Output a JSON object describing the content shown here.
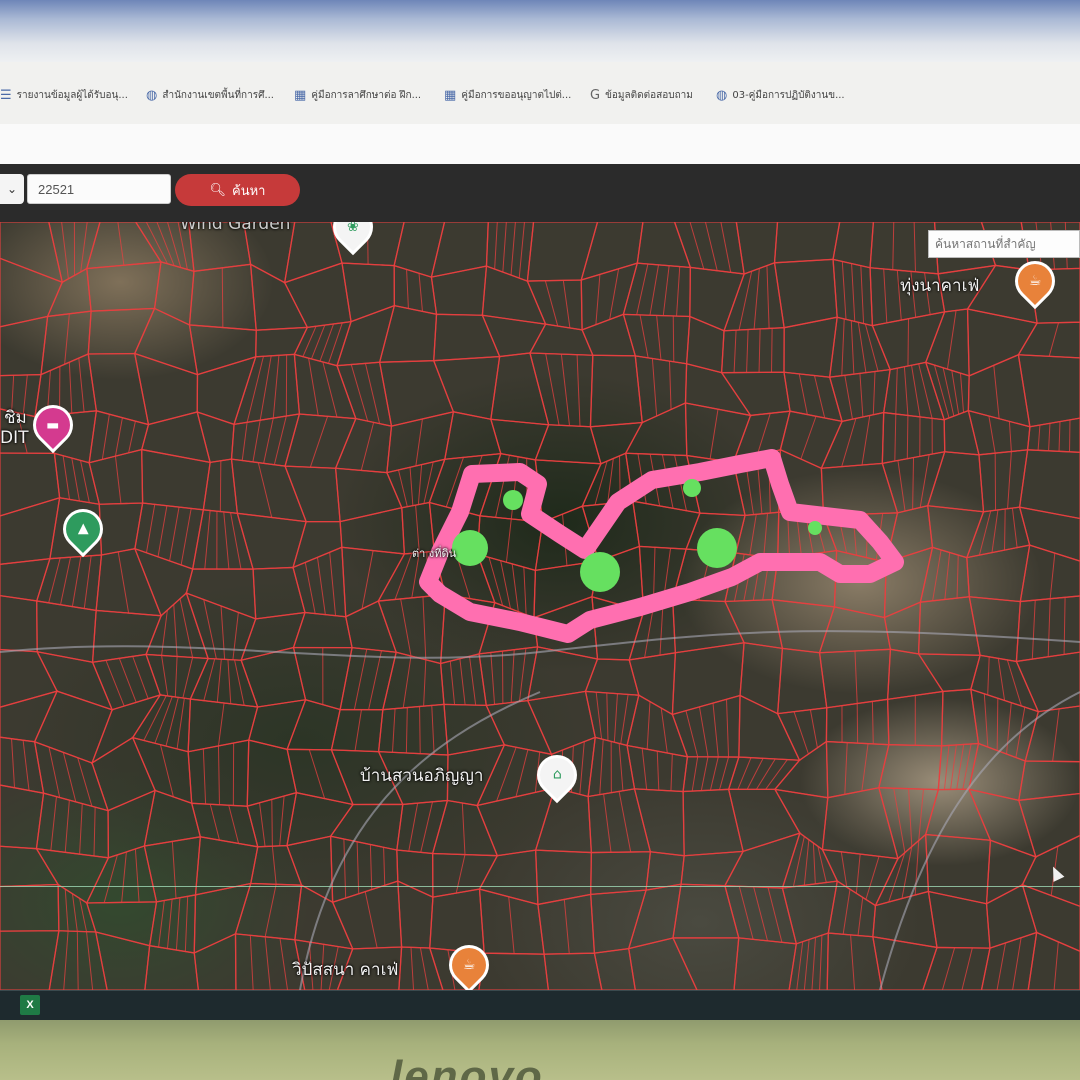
{
  "bookmarks": [
    {
      "label": "รายงานข้อมูลผู้ได้รับอนุ...",
      "icon": "list-icon"
    },
    {
      "label": "สำนักงานเขตพื้นที่การศึ...",
      "icon": "globe-icon"
    },
    {
      "label": "คู่มือการลาศึกษาต่อ ฝึก...",
      "icon": "form-icon"
    },
    {
      "label": "คู่มือการขออนุญาตไปต่...",
      "icon": "form-icon"
    },
    {
      "label": "ข้อมูลติดต่อสอบถาม",
      "icon": "google-icon"
    },
    {
      "label": "03-คู่มือการปฏิบัติงานข...",
      "icon": "globe-icon"
    }
  ],
  "search": {
    "select_value": "",
    "code_value": "22521",
    "button_label": "ค้นหา"
  },
  "map": {
    "place_search_placeholder": "ค้นหาสถานที่สำคัญ",
    "labels": {
      "wind_garden": "Wind Garden",
      "top_right_cafe": "ทุ่งนาคาเฟ่",
      "left_place": "ชิม",
      "left_place_sub": "DIT",
      "center_label": "ต่า        งที่ดิน",
      "village": "บ้านสวนอภิญญา",
      "bottom_cafe": "วิปัสสนา คาเฟ่"
    },
    "highlight_color": "#ff6fb0",
    "marker_color": "#66e060",
    "parcel_color": "#e84040"
  },
  "taskbar": {
    "app_icon_letter": "X"
  },
  "brand": "lenovo"
}
